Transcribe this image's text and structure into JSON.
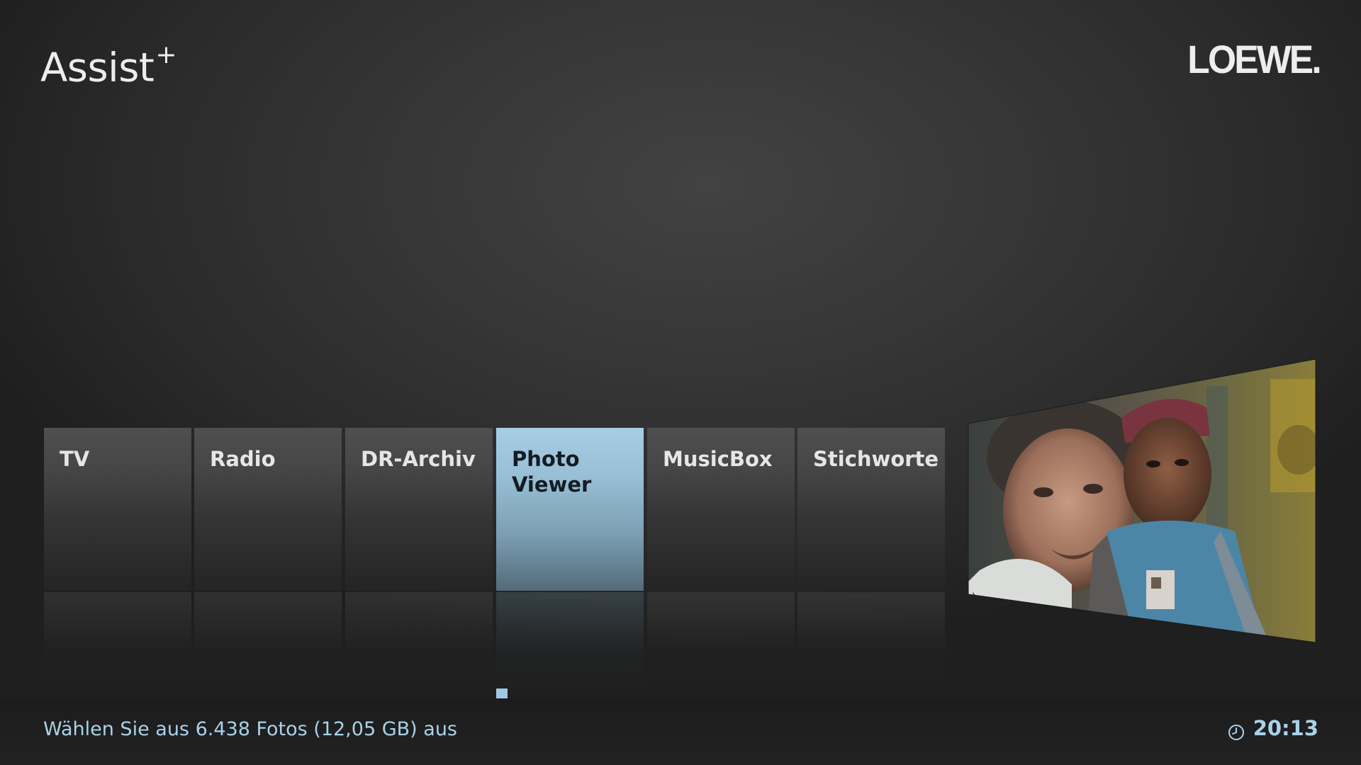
{
  "header": {
    "app_title": "Assist",
    "app_title_sup": "+",
    "brand_logo": "LOEWE."
  },
  "menu": {
    "selected_index": 3,
    "items": [
      {
        "label": "TV"
      },
      {
        "label": "Radio"
      },
      {
        "label": "DR-Archiv"
      },
      {
        "label": "Photo\nViewer"
      },
      {
        "label": "MusicBox"
      },
      {
        "label": "Stichworte"
      }
    ]
  },
  "preview": {
    "icon": "live-tv-preview-image"
  },
  "status": {
    "message": "Wählen Sie aus 6.438 Fotos (12,05 GB) aus",
    "time": "20:13",
    "clock_icon": "clock-icon"
  },
  "colors": {
    "accent": "#a9d2ea",
    "selected_tile": "#a7cde4",
    "background": "#2f2f2f"
  }
}
